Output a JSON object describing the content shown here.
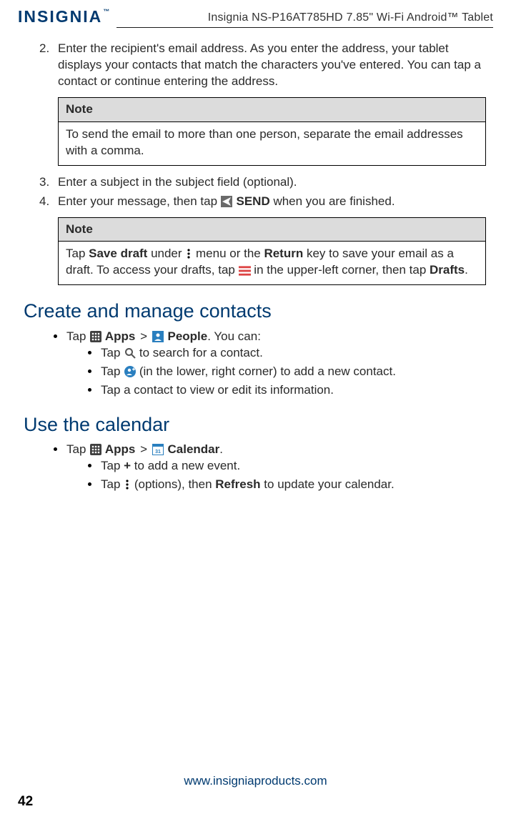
{
  "header": {
    "brand": "INSIGNIA",
    "product": "Insignia  NS-P16AT785HD  7.85\" Wi-Fi Android™ Tablet"
  },
  "steps_a": {
    "s2_num": "2.",
    "s2_text": "Enter the recipient's email address. As you enter the address, your tablet displays your contacts that match the characters you've entered. You can tap a contact or continue entering the address."
  },
  "note1": {
    "head": "Note",
    "body": "To send the email to more than one person, separate the email addresses with a comma."
  },
  "steps_b": {
    "s3_num": "3.",
    "s3_text": "Enter a subject in the subject field (optional).",
    "s4_num": "4.",
    "s4_pre": "Enter your message, then tap ",
    "s4_bold": "SEND",
    "s4_post": " when you are finished."
  },
  "note2": {
    "head": "Note",
    "b1_pre": "Tap ",
    "b1_bold1": "Save draft",
    "b1_mid1": " under ",
    "b1_mid2": " menu or the ",
    "b1_bold2": "Return",
    "b1_mid3": " key to save your email as a draft. To access your drafts, tap ",
    "b1_mid4": " in the upper-left corner, then tap ",
    "b1_bold3": "Drafts",
    "b1_end": "."
  },
  "sec1": {
    "title": "Create and manage contacts",
    "l1_pre": "Tap ",
    "l1_b1": "Apps",
    "l1_gt": " > ",
    "l1_b2": "People",
    "l1_post": ". You can:",
    "sub1_pre": "Tap ",
    "sub1_post": " to search for a contact.",
    "sub2_pre": "Tap ",
    "sub2_post": " (in the lower, right corner) to add a new contact.",
    "sub3": "Tap a contact to view or edit its information."
  },
  "sec2": {
    "title": "Use the calendar",
    "l1_pre": "Tap ",
    "l1_b1": "Apps",
    "l1_gt": " > ",
    "l1_b2": "Calendar",
    "l1_post": ".",
    "sub1_pre": "Tap ",
    "sub1_b": "+",
    "sub1_post": " to add a new event.",
    "sub2_pre": "Tap ",
    "sub2_mid": " (options), then ",
    "sub2_b": "Refresh",
    "sub2_post": " to update your calendar."
  },
  "footer": {
    "url": "www.insigniaproducts.com",
    "page": "42"
  }
}
